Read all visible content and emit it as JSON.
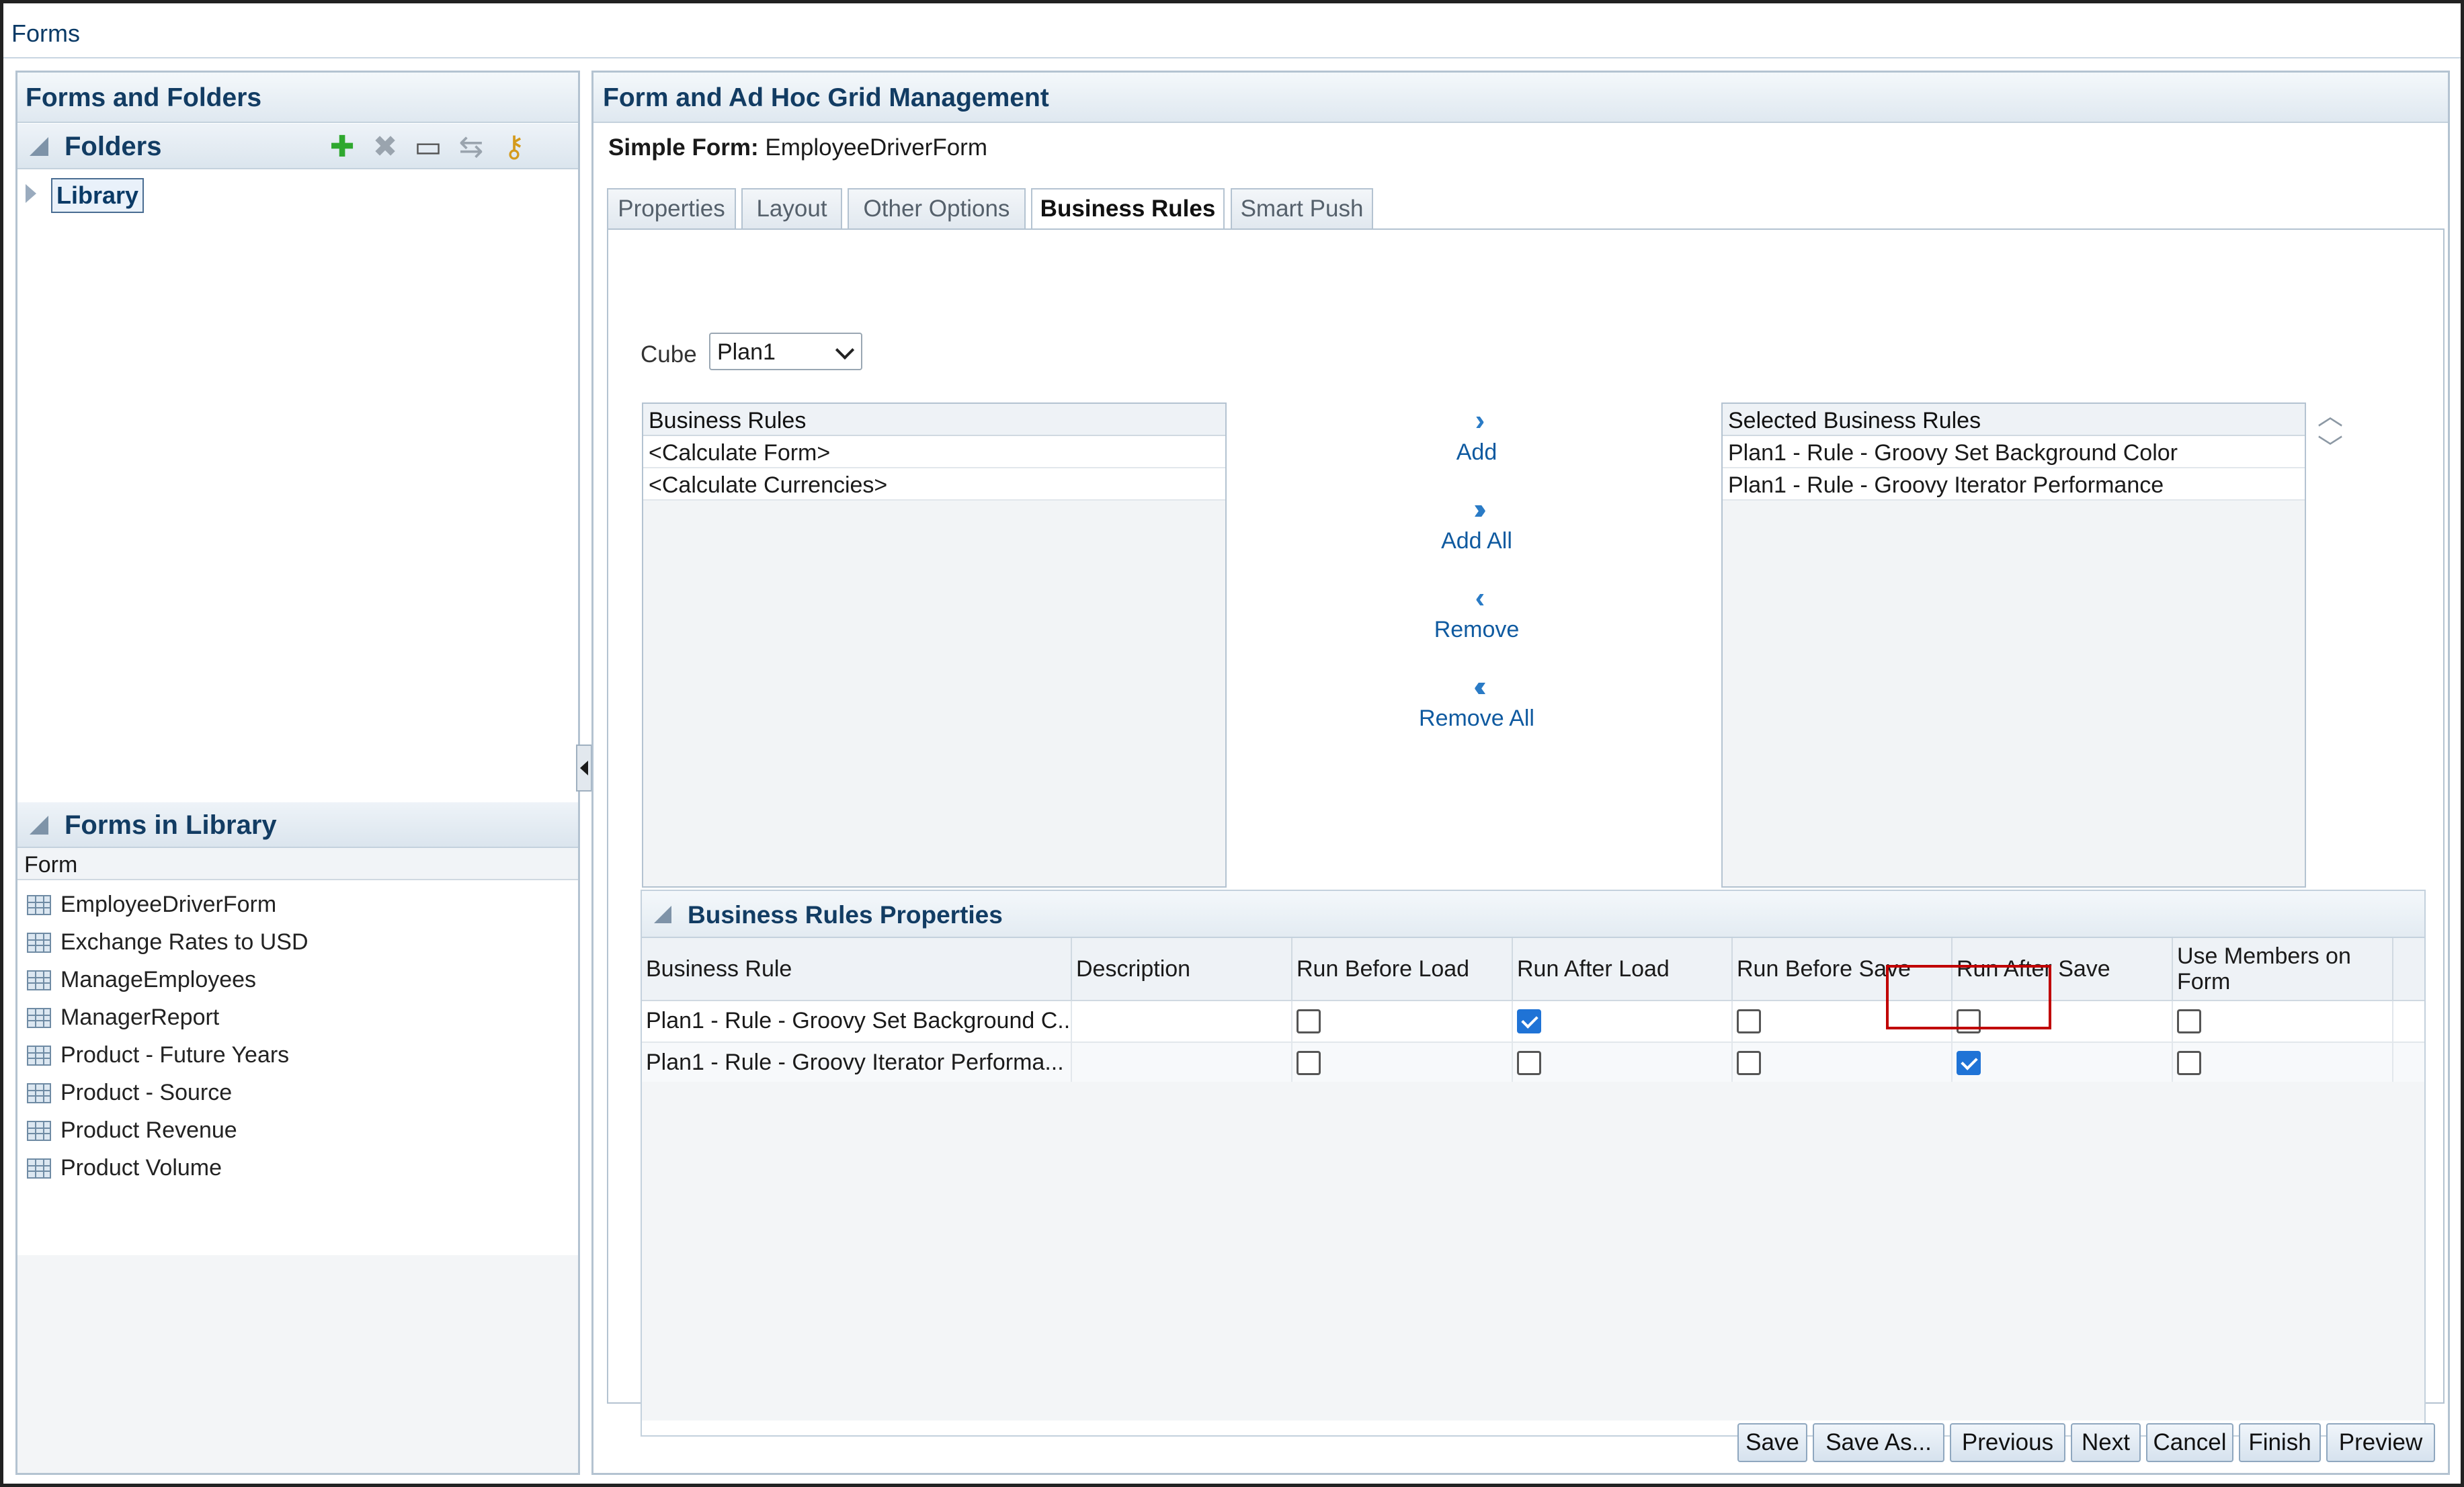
{
  "window": {
    "title": "Forms"
  },
  "left": {
    "title": "Forms and Folders",
    "folders": {
      "heading": "Folders",
      "toolbar": [
        "add-folder-icon",
        "delete-folder-icon",
        "rename-folder-icon",
        "move-folder-icon",
        "assign-access-icon"
      ],
      "tree": [
        {
          "label": "Library",
          "expanded": false,
          "selected": true
        }
      ]
    },
    "forms_in_library": {
      "heading": "Forms in Library",
      "column": "Form",
      "items": [
        "EmployeeDriverForm",
        "Exchange Rates to USD",
        "ManageEmployees",
        "ManagerReport",
        "Product - Future Years",
        "Product - Source",
        "Product Revenue",
        "Product Volume"
      ]
    }
  },
  "main": {
    "title": "Form and Ad Hoc Grid Management",
    "simple_form_label": "Simple Form:",
    "simple_form_name": "EmployeeDriverForm",
    "tabs": [
      {
        "label": "Properties",
        "active": false
      },
      {
        "label": "Layout",
        "active": false
      },
      {
        "label": "Other Options",
        "active": false
      },
      {
        "label": "Business Rules",
        "active": true
      },
      {
        "label": "Smart Push",
        "active": false
      }
    ],
    "cube": {
      "label": "Cube",
      "value": "Plan1"
    },
    "available_rules": {
      "header": "Business Rules",
      "items": [
        "<Calculate Form>",
        "<Calculate Currencies>"
      ]
    },
    "shuttle": {
      "add": "Add",
      "add_all": "Add All",
      "remove": "Remove",
      "remove_all": "Remove All"
    },
    "selected_rules": {
      "header": "Selected Business Rules",
      "items": [
        "Plan1 - Rule - Groovy Set Background Color",
        "Plan1 - Rule - Groovy Iterator Performance"
      ]
    },
    "properties": {
      "title": "Business Rules Properties",
      "columns": [
        "Business Rule",
        "Description",
        "Run Before Load",
        "Run After Load",
        "Run Before Save",
        "Run After Save",
        "Use Members on Form"
      ],
      "rows": [
        {
          "rule": "Plan1 - Rule - Groovy Set Background C...",
          "description": "",
          "run_before_load": false,
          "run_after_load": true,
          "run_before_save": false,
          "run_after_save": false,
          "use_members_on_form": false
        },
        {
          "rule": "Plan1 - Rule - Groovy Iterator Performa...",
          "description": "",
          "run_before_load": false,
          "run_after_load": false,
          "run_before_save": false,
          "run_after_save": true,
          "use_members_on_form": false
        }
      ]
    },
    "buttons": [
      "Save",
      "Save As...",
      "Previous",
      "Next",
      "Cancel",
      "Finish",
      "Preview"
    ]
  },
  "colors": {
    "highlight": "#c00000",
    "checkbox_on": "#1f73d6",
    "heading": "#123c63"
  }
}
